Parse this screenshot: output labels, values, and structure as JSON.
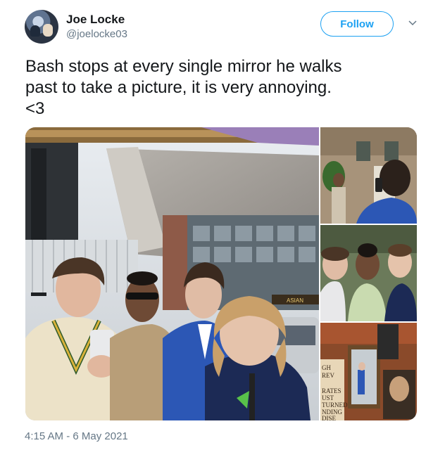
{
  "author": {
    "name": "Joe Locke",
    "handle": "@joelocke03"
  },
  "follow_button": {
    "label": "Follow"
  },
  "tweet": {
    "text": "Bash stops at every single mirror he walks\npast to take a picture, it is very annoying.\n<3",
    "timestamp": "4:15 AM - 6 May 2021"
  },
  "media": {
    "main_photo_sign": "ASIAN",
    "mirror_photo_sign_lines": [
      "GH",
      "REV",
      "",
      "RATES",
      "UST",
      "TURNED",
      "NDING",
      "DISE"
    ]
  },
  "colors": {
    "accent": "#1da1f2",
    "secondary_text": "#657786",
    "primary_text": "#14171a"
  },
  "icons": {
    "chevron": "chevron-down-icon"
  }
}
